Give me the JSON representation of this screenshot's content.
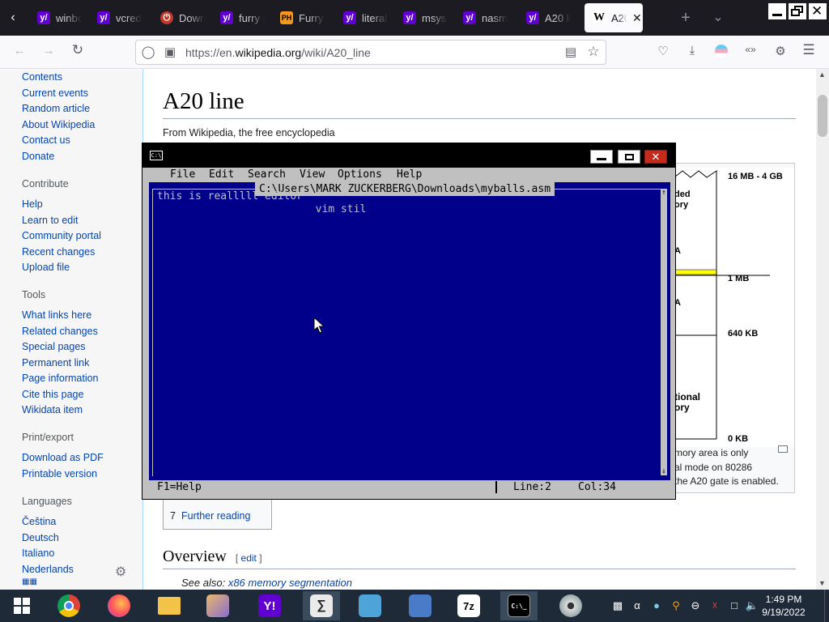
{
  "browser": {
    "tabs": [
      {
        "label": "winbo",
        "favicon": "yahoo"
      },
      {
        "label": "vcredi",
        "favicon": "yahoo"
      },
      {
        "label": "Down",
        "favicon": "power"
      },
      {
        "label": "furry p",
        "favicon": "yahoo"
      },
      {
        "label": "Furry",
        "favicon": "ph"
      },
      {
        "label": "literal",
        "favicon": "yahoo"
      },
      {
        "label": "msys",
        "favicon": "yahoo"
      },
      {
        "label": "nasm",
        "favicon": "yahoo"
      },
      {
        "label": "A20 li",
        "favicon": "yahoo"
      },
      {
        "label": "A20",
        "favicon": "wikipedia",
        "active": true
      }
    ],
    "active_tab_favicon_letter": "W",
    "new_tab_symbol": "+",
    "url": {
      "prefix": "https://en.",
      "domain": "wikipedia.org",
      "path": "/wiki/A20_line"
    },
    "colors": {
      "tabbar": "#1c1b22",
      "yahoo_purple": "#6001d2"
    }
  },
  "sidebar": {
    "nav_links": [
      "Contents",
      "Current events",
      "Random article",
      "About Wikipedia",
      "Contact us",
      "Donate"
    ],
    "contribute_heading": "Contribute",
    "contribute_links": [
      "Help",
      "Learn to edit",
      "Community portal",
      "Recent changes",
      "Upload file"
    ],
    "tools_heading": "Tools",
    "tools_links": [
      "What links here",
      "Related changes",
      "Special pages",
      "Permanent link",
      "Page information",
      "Cite this page",
      "Wikidata item"
    ],
    "print_heading": "Print/export",
    "print_links": [
      "Download as PDF",
      "Printable version"
    ],
    "languages_heading": "Languages",
    "language_links": [
      "Čeština",
      "Deutsch",
      "Italiano",
      "Nederlands"
    ]
  },
  "article": {
    "title": "A20 line",
    "tagline": "From Wikipedia, the free encyclopedia",
    "diagram_labels": {
      "top": "16 MB - 4 GB",
      "one_mb": "1 MB",
      "k640": "640 KB",
      "zero": "0 KB",
      "ext_a": "ded",
      "ext_b": "ory",
      "conv_a": "tional",
      "conv_b": "ory",
      "hma_a": "A",
      "hma_b": "A"
    },
    "caption_lines": [
      "mory area is only",
      "al mode on 80286",
      "the A20 gate is enabled."
    ],
    "toc_number": "7",
    "toc_link": "Further reading",
    "section_heading": "Overview",
    "edit_open": "[",
    "edit_link": "edit",
    "edit_close": "]",
    "see_also_prefix": "See also:",
    "see_also_link": "x86 memory segmentation"
  },
  "console": {
    "menu": [
      "File",
      "Edit",
      "Search",
      "View",
      "Options",
      "Help"
    ],
    "file_path": "C:\\Users\\MARK ZUCKERBERG\\Downloads\\myballs.asm",
    "lines": [
      "this is realllll editor",
      "                         vim stil"
    ],
    "status_help": "F1=Help",
    "status_line": "Line:2",
    "status_col": "Col:34",
    "colors": {
      "editor_bg": "#00008b",
      "editor_fg": "#c0c0c0",
      "chrome": "#c0c0c0"
    }
  },
  "taskbar": {
    "clock_time": "1:49 PM",
    "clock_date": "9/19/2022"
  }
}
